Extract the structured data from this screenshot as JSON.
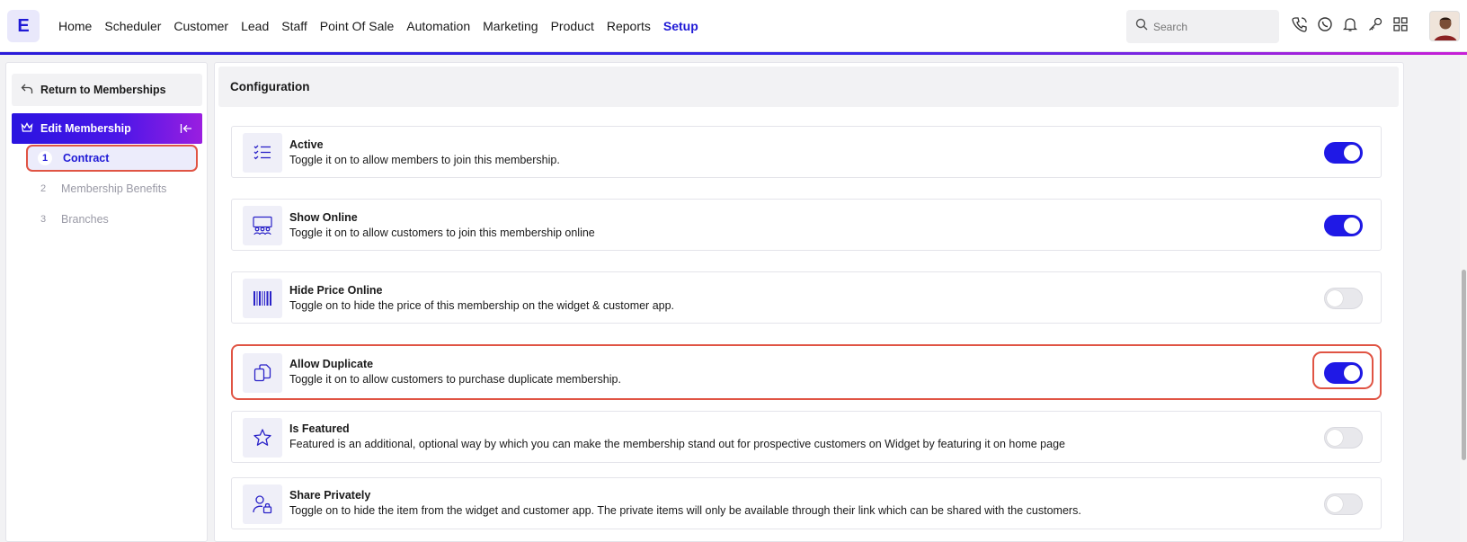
{
  "app": {
    "logo_letter": "E"
  },
  "nav": {
    "items": [
      {
        "label": "Home"
      },
      {
        "label": "Scheduler"
      },
      {
        "label": "Customer"
      },
      {
        "label": "Lead"
      },
      {
        "label": "Staff"
      },
      {
        "label": "Point Of Sale"
      },
      {
        "label": "Automation"
      },
      {
        "label": "Marketing"
      },
      {
        "label": "Product"
      },
      {
        "label": "Reports"
      },
      {
        "label": "Setup"
      }
    ],
    "active": "Setup"
  },
  "search": {
    "placeholder": "Search"
  },
  "top_icons": [
    "phone-icon",
    "whatsapp-icon",
    "bell-icon",
    "key-icon",
    "grid-icon"
  ],
  "sidebar": {
    "return_label": "Return to Memberships",
    "section_title": "Edit Membership",
    "steps": [
      {
        "num": "1",
        "label": "Contract",
        "active": true
      },
      {
        "num": "2",
        "label": "Membership Benefits",
        "active": false
      },
      {
        "num": "3",
        "label": "Branches",
        "active": false
      }
    ]
  },
  "main": {
    "header": "Configuration",
    "settings": [
      {
        "icon": "checklist-icon",
        "title": "Active",
        "description": "Toggle it on to allow members to join this membership.",
        "enabled": true
      },
      {
        "icon": "online-audience-icon",
        "title": "Show Online",
        "description": "Toggle it on to allow customers to join this membership online",
        "enabled": true
      },
      {
        "icon": "barcode-icon",
        "title": "Hide Price Online",
        "description": "Toggle on to hide the price of this membership on the widget & customer app.",
        "enabled": false
      },
      {
        "icon": "duplicate-icon",
        "title": "Allow Duplicate",
        "description": "Toggle it on to allow customers to purchase duplicate membership.",
        "enabled": true
      },
      {
        "icon": "star-icon",
        "title": "Is Featured",
        "description": "Featured is an additional, optional way by which you can make the membership stand out for prospective customers on Widget by featuring it on home page",
        "enabled": false
      },
      {
        "icon": "user-lock-icon",
        "title": "Share Privately",
        "description": "Toggle on to hide the item from the widget and customer app. The private items will only be available through their link which can be shared with the customers.",
        "enabled": false
      }
    ]
  },
  "colors": {
    "accent": "#1f19e6",
    "highlight": "#e05444"
  }
}
